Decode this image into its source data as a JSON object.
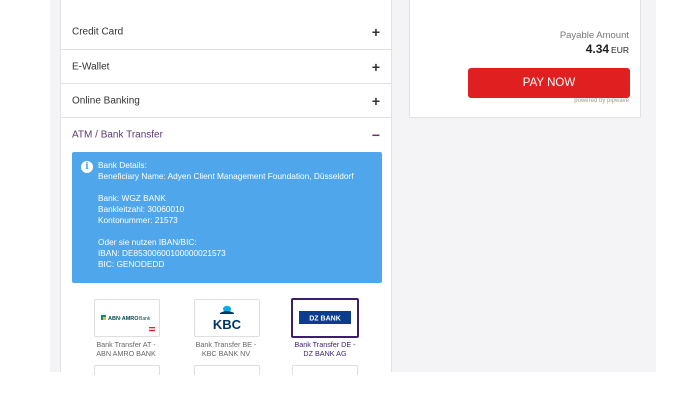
{
  "payment_methods": [
    {
      "label": "Credit Card",
      "toggle": "+"
    },
    {
      "label": "E-Wallet",
      "toggle": "+"
    },
    {
      "label": "Online Banking",
      "toggle": "+"
    },
    {
      "label": "ATM / Bank Transfer",
      "toggle": "−"
    }
  ],
  "bank_details": {
    "icon": "info-icon",
    "text": "Bank Details:\nBeneficiary Name: Adyen Client Management Foundation, Düsseldorf\n\nBank: WGZ BANK\nBankleitzahl: 30060010\nKontonummer: 21573\n\nOder sie nutzen IBAN/BIC:\nIBAN: DE85300600100000021573\nBIC: GENODEDD"
  },
  "banks": [
    {
      "logo_text": "ABN·AMRO",
      "logo_sub": "Bank",
      "caption_line1": "Bank Transfer AT -",
      "caption_line2": "ABN AMRO BANK",
      "selected": false
    },
    {
      "logo_text": "KBC",
      "caption_line1": "Bank Transfer BE -",
      "caption_line2": "KBC BANK NV",
      "selected": false
    },
    {
      "logo_text": "DZ BANK",
      "caption_line1": "Bank Transfer DE -",
      "caption_line2": "DZ BANK AG",
      "selected": true
    }
  ],
  "summary": {
    "payable_label": "Payable Amount",
    "amount": "4.34",
    "currency": "EUR",
    "pay_button": "PAY NOW",
    "powered_by": "powered by pipwave"
  },
  "colors": {
    "accent": "#5b3a78",
    "info_bg": "#4fa6ea",
    "pay_button": "#e02020",
    "selected_border": "#3b1f6e"
  }
}
